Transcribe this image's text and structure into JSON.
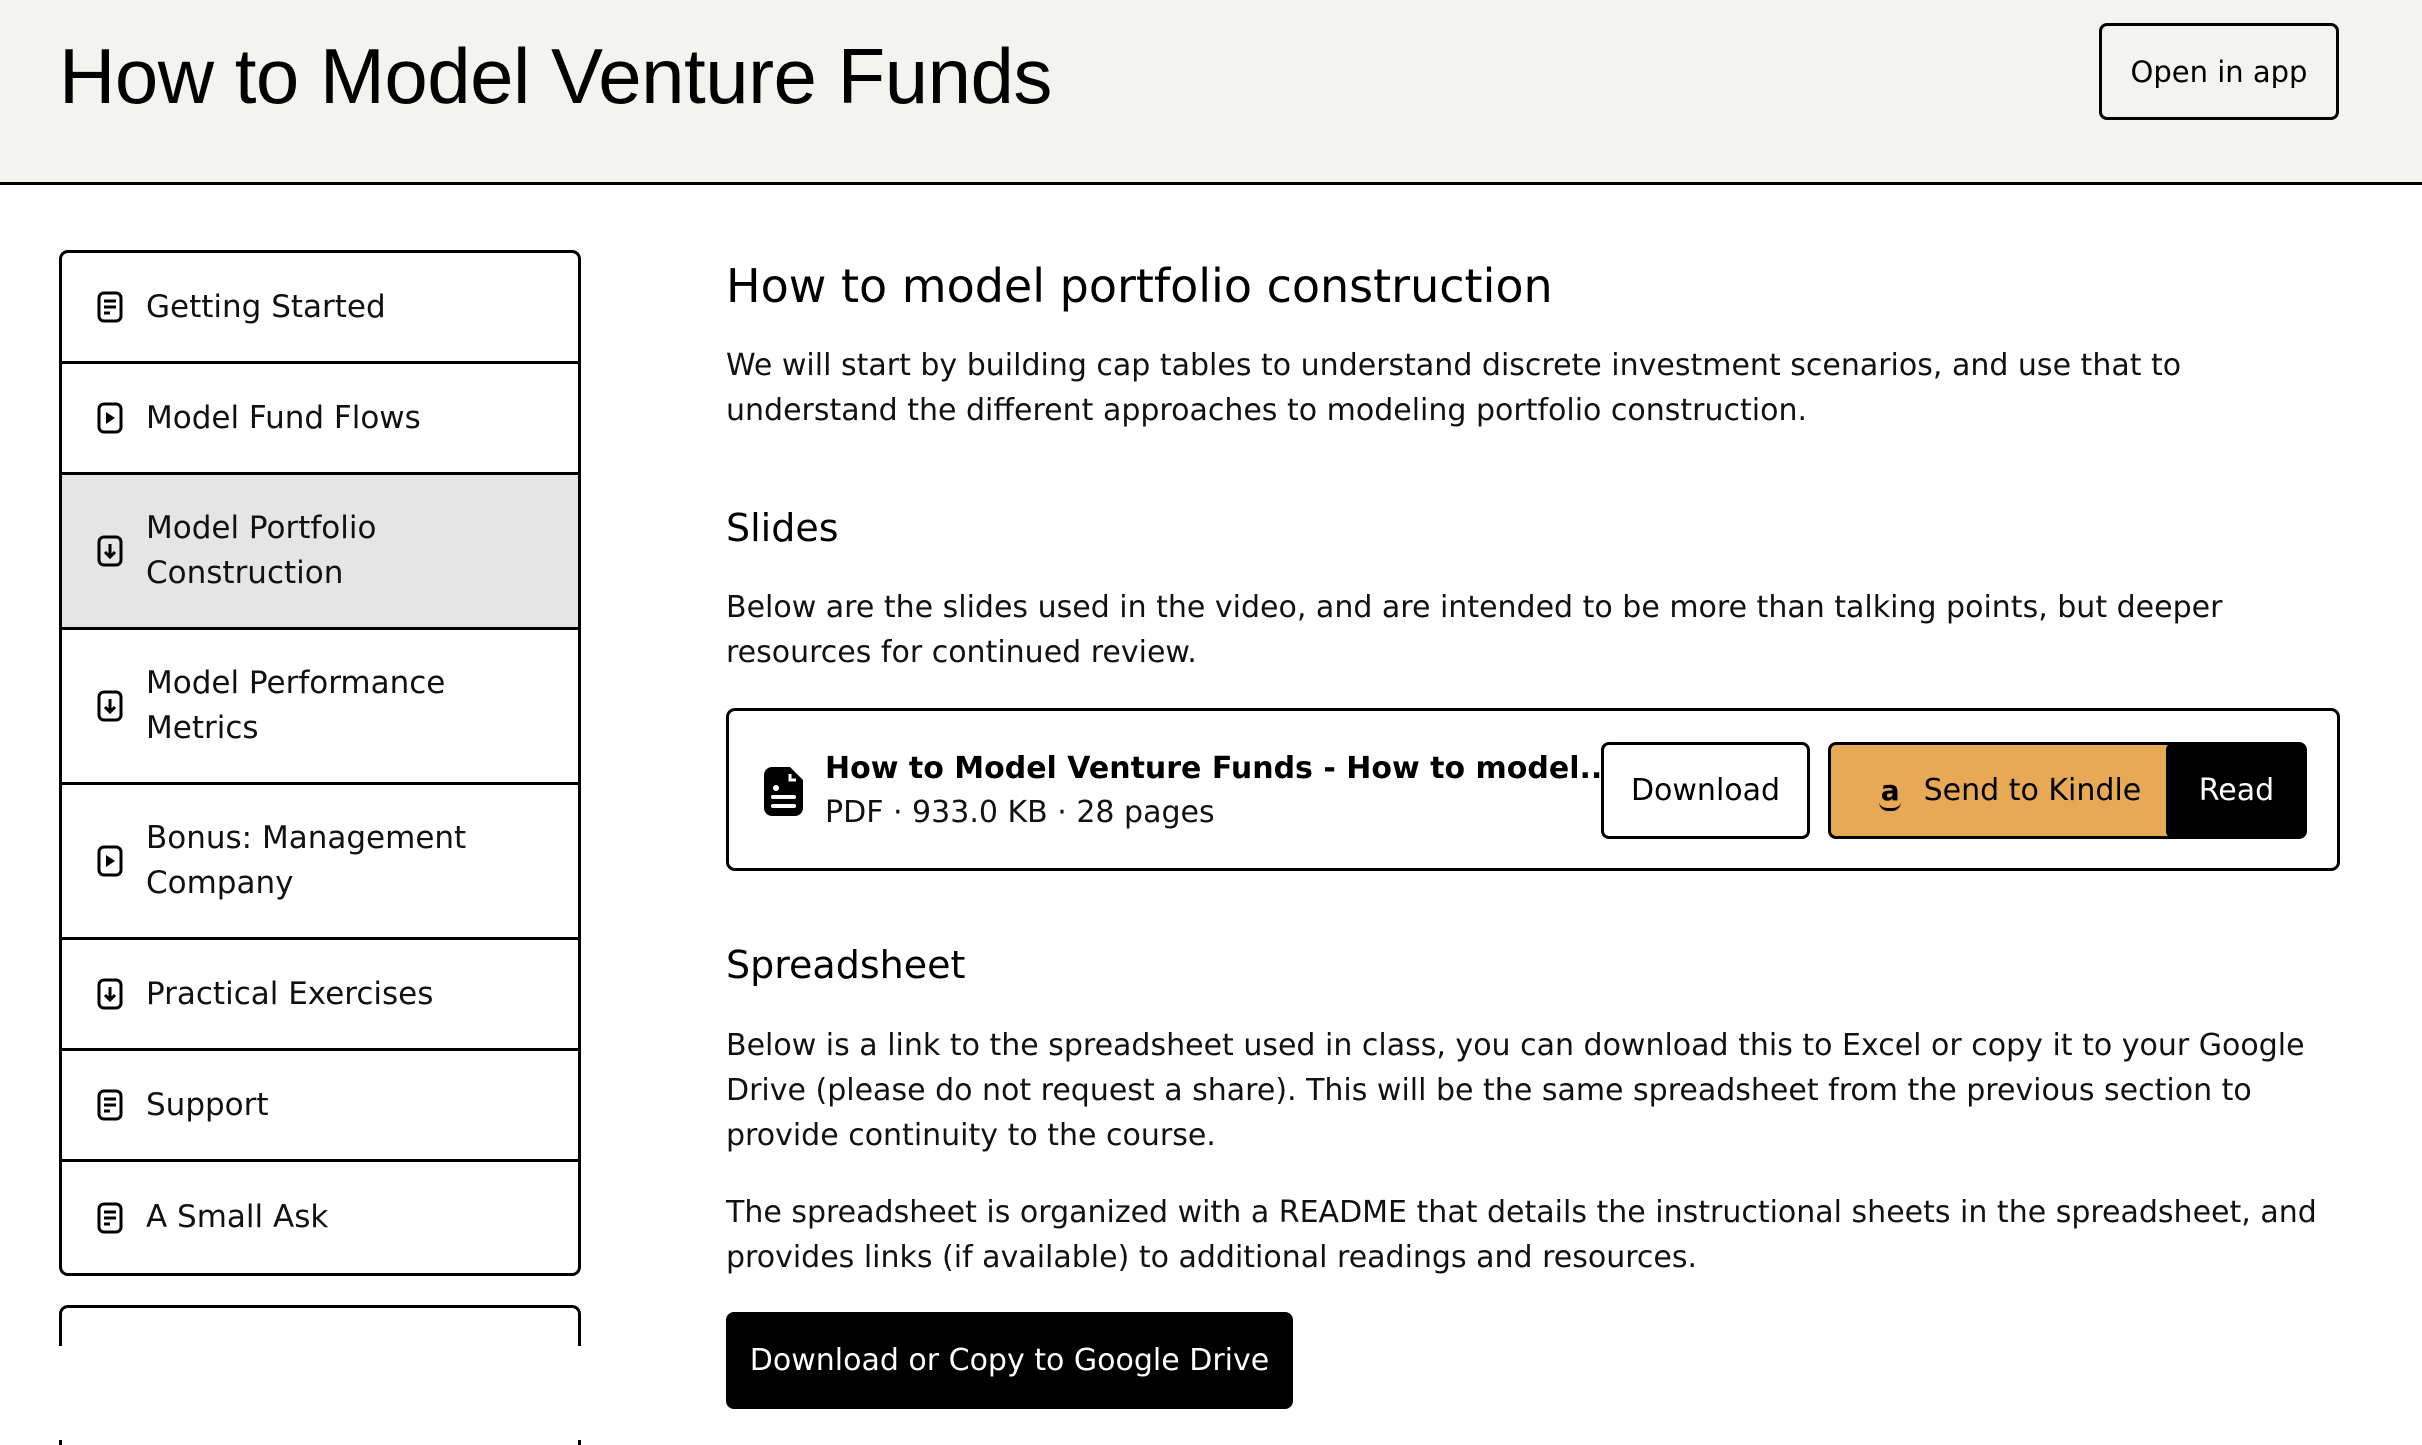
{
  "header": {
    "title": "How to Model Venture Funds",
    "open_in_app_label": "Open in app"
  },
  "sidebar": {
    "items": [
      {
        "label": "Getting Started",
        "icon": "document-icon",
        "active": false
      },
      {
        "label": "Model Fund Flows",
        "icon": "play-icon",
        "active": false
      },
      {
        "label": "Model Portfolio Construction",
        "icon": "download-icon",
        "active": true
      },
      {
        "label": "Model Performance Metrics",
        "icon": "download-icon",
        "active": false
      },
      {
        "label": "Bonus: Management Company",
        "icon": "play-icon",
        "active": false
      },
      {
        "label": "Practical Exercises",
        "icon": "download-icon",
        "active": false
      },
      {
        "label": "Support",
        "icon": "document-icon",
        "active": false
      },
      {
        "label": "A Small Ask",
        "icon": "document-icon",
        "active": false
      }
    ]
  },
  "main": {
    "title": "How to model portfolio construction",
    "intro": "We will start by building cap tables to understand discrete investment scenarios, and use that to understand the different approaches to modeling portfolio construction.",
    "slides": {
      "heading": "Slides",
      "description": "Below are the slides used in the video, and are intended to be more than talking points, but deeper resources for continued review.",
      "file": {
        "name": "How to Model Venture Funds - How to model...",
        "meta": "PDF · 933.0 KB · 28 pages",
        "icon": "file-icon"
      },
      "download_label": "Download",
      "kindle_label": "Send to Kindle",
      "kindle_icon": "amazon-icon",
      "kindle_glyph": "a",
      "read_label": "Read"
    },
    "spreadsheet": {
      "heading": "Spreadsheet",
      "paragraph1": "Below is a link to the spreadsheet used in class, you can download this to Excel or copy it to your Google Drive (please do not request a share). This will be the same spreadsheet from the previous section to provide continuity to the course.",
      "paragraph2": "The spreadsheet is organized with a README that details the instructional sheets in the spreadsheet, and provides links (if available) to additional readings and resources.",
      "button_label": "Download or Copy to Google Drive"
    }
  },
  "colors": {
    "header_bg": "#f3f3ef",
    "active_item_bg": "#e5e5e5",
    "kindle_button": "#e8a956",
    "primary_button": "#000000"
  }
}
